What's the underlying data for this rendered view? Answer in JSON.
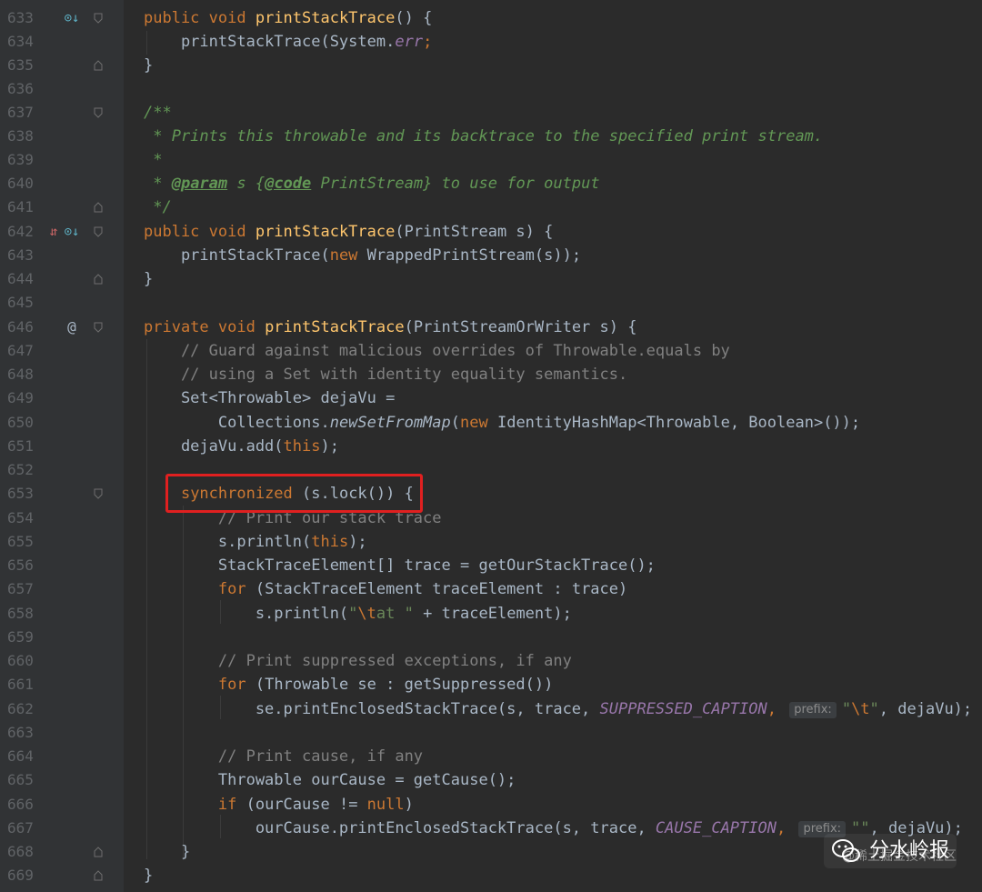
{
  "editor": {
    "lines": [
      {
        "n": "633",
        "gutter": "override-icon"
      },
      {
        "n": "634"
      },
      {
        "n": "635"
      },
      {
        "n": "636"
      },
      {
        "n": "637"
      },
      {
        "n": "638"
      },
      {
        "n": "639"
      },
      {
        "n": "640"
      },
      {
        "n": "641"
      },
      {
        "n": "642",
        "gutter": "implemented-overridden-icon"
      },
      {
        "n": "643"
      },
      {
        "n": "644"
      },
      {
        "n": "645"
      },
      {
        "n": "646",
        "gutter": "at-icon"
      },
      {
        "n": "647"
      },
      {
        "n": "648"
      },
      {
        "n": "649"
      },
      {
        "n": "650"
      },
      {
        "n": "651"
      },
      {
        "n": "652"
      },
      {
        "n": "653"
      },
      {
        "n": "654"
      },
      {
        "n": "655"
      },
      {
        "n": "656"
      },
      {
        "n": "657"
      },
      {
        "n": "658"
      },
      {
        "n": "659"
      },
      {
        "n": "660"
      },
      {
        "n": "661"
      },
      {
        "n": "662"
      },
      {
        "n": "663"
      },
      {
        "n": "664"
      },
      {
        "n": "665"
      },
      {
        "n": "666"
      },
      {
        "n": "667"
      },
      {
        "n": "668"
      },
      {
        "n": "669"
      }
    ],
    "highlight": "synchronized (s.lock()) {",
    "hint_prefix": "prefix:",
    "at_symbol": "@"
  },
  "code": {
    "l633": {
      "kw": "public void ",
      "fn": "printStackTrace",
      "rest": "() {"
    },
    "l634": {
      "pre": "    printStackTrace(System.",
      "italic": "err",
      "rest": ");"
    },
    "l635": "}",
    "l637": "/**",
    "l638": " * Prints this throwable and its backtrace to the specified print stream.",
    "l639": " *",
    "l640": {
      "pre": " * ",
      "tag1": "@param",
      "mid": " s {",
      "tag2": "@code",
      "rest": " PrintStream} to use for output"
    },
    "l641": " */",
    "l642": {
      "kw": "public void ",
      "fn": "printStackTrace",
      "rest": "(PrintStream s) {"
    },
    "l643": {
      "pre": "    printStackTrace(",
      "kw": "new ",
      "rest": "WrappedPrintStream(s));"
    },
    "l644": "}",
    "l646": {
      "kw": "private void ",
      "fn": "printStackTrace",
      "rest": "(PrintStreamOrWriter s) {"
    },
    "l647": "    // Guard against malicious overrides of Throwable.equals by",
    "l648": "    // using a Set with identity equality semantics.",
    "l649": "    Set<Throwable> dejaVu =",
    "l650": {
      "pre": "        Collections.",
      "italic": "newSetFromMap",
      "p2": "(",
      "kw": "new ",
      "rest": "IdentityHashMap<Throwable, Boolean>());"
    },
    "l651": {
      "pre": "    dejaVu.add(",
      "kw": "this",
      "rest": ");"
    },
    "l653": {
      "pre": "    ",
      "kw": "synchronized ",
      "rest": "(s.lock()) {"
    },
    "l654": "        // Print our stack trace",
    "l655": {
      "pre": "        s.println(",
      "kw": "this",
      "rest": ");"
    },
    "l656": "        StackTraceElement[] trace = getOurStackTrace();",
    "l657": {
      "pre": "        ",
      "kw": "for ",
      "rest": "(StackTraceElement traceElement : trace)"
    },
    "l658": {
      "pre": "            s.println(",
      "s1": "\"",
      "esc": "\\t",
      "s2": "at \"",
      "rest": " + traceElement);"
    },
    "l660": "        // Print suppressed exceptions, if any",
    "l661": {
      "pre": "        ",
      "kw": "for ",
      "rest": "(Throwable se : getSuppressed())"
    },
    "l662": {
      "pre": "            se.printEnclosedStackTrace(s, trace, ",
      "const": "SUPPRESSED_CAPTION",
      "str_open": "\"",
      "esc": "\\t",
      "str_close": "\"",
      "rest": ", dejaVu);"
    },
    "l664": "        // Print cause, if any",
    "l665": "        Throwable ourCause = getCause();",
    "l666": {
      "pre": "        ",
      "kw": "if ",
      "p2": "(ourCause != ",
      "kw2": "null",
      "rest": ")"
    },
    "l667": {
      "pre": "            ourCause.printEnclosedStackTrace(s, trace, ",
      "const": "CAUSE_CAPTION",
      "str": "\"\"",
      "rest": ", dejaVu);"
    },
    "l668": "    }",
    "l669": "}"
  },
  "watermark": {
    "title": "分水岭报",
    "subtitle": "@稀土掘金技术社区"
  },
  "colors": {
    "background": "#2b2b2b",
    "gutter": "#313335",
    "keyword": "#cc7832",
    "function": "#ffc66d",
    "comment": "#808080",
    "doc": "#629755",
    "constant": "#9876aa",
    "string": "#6a8759",
    "highlight_box": "#e02020"
  }
}
